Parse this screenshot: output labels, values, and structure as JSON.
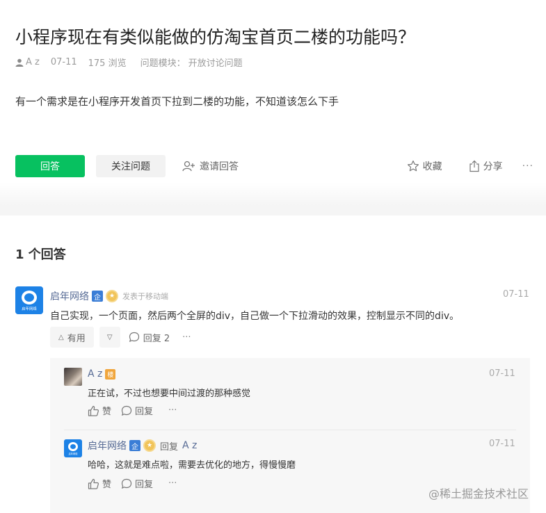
{
  "question": {
    "title": "小程序现在有类似能做的仿淘宝首页二楼的功能吗？",
    "author": "A z",
    "date": "07-11",
    "views": "175 浏览",
    "module_label": "问题模块：",
    "module_value": "开放讨论问题",
    "body": "有一个需求是在小程序开发首页下拉到二楼的功能，不知道该怎么下手"
  },
  "actions": {
    "answer": "回答",
    "follow": "关注问题",
    "invite": "邀请回答",
    "favorite": "收藏",
    "share": "分享",
    "more": "···"
  },
  "answers_header": "1 个回答",
  "answer": {
    "user": "启年网络",
    "enterprise_badge": "企",
    "posted_from": "发表于移动端",
    "date": "07-11",
    "text": "自己实现，一个页面，然后两个全屏的div，自己做一个下拉滑动的效果，控制显示不同的div。",
    "useful": "有用",
    "reply_count": "回复 2",
    "more": "···",
    "logo_text": "启年网络"
  },
  "replies": [
    {
      "user": "A z",
      "badge": "楼",
      "date": "07-11",
      "text": "正在试，不过也想要中间过渡的那种感觉",
      "like": "赞",
      "reply": "回复",
      "more": "···"
    },
    {
      "user": "启年网络",
      "badge": "企",
      "reply_label": "回复",
      "reply_to": "A z",
      "date": "07-11",
      "text": "哈哈，这就是难点啦，需要去优化的地方，得慢慢磨",
      "like": "赞",
      "reply": "回复",
      "more": "···",
      "logo_text": "启年网络"
    }
  ],
  "watermark": "@稀土掘金技术社区",
  "colors": {
    "primary_green": "#07c160",
    "link_blue": "#576b95",
    "logo_blue": "#1d82e6"
  }
}
